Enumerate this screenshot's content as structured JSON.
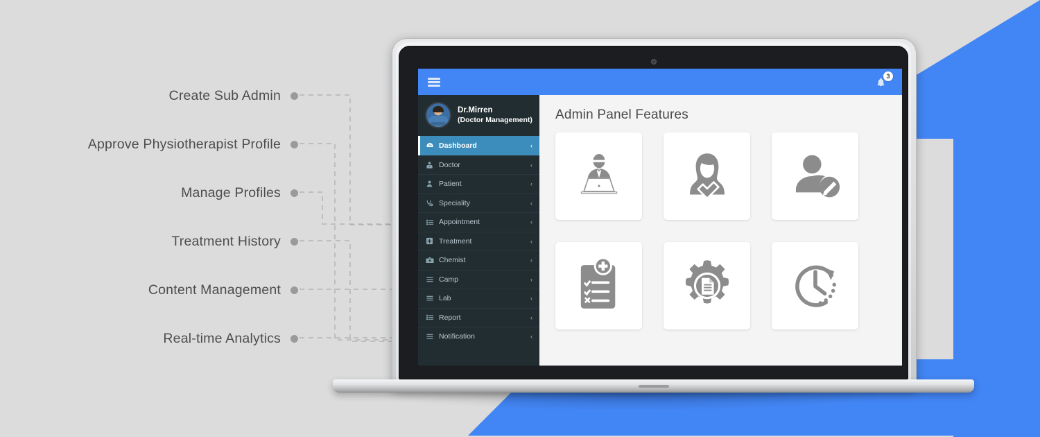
{
  "background": {
    "page_bg": "#dcdcdc",
    "accent_blue": "#4285f4"
  },
  "callouts": [
    {
      "label": "Create Sub Admin"
    },
    {
      "label": "Approve Physiotherapist Profile"
    },
    {
      "label": "Manage Profiles"
    },
    {
      "label": "Treatment History"
    },
    {
      "label": "Content Management"
    },
    {
      "label": "Real-time  Analytics"
    }
  ],
  "app": {
    "topbar": {
      "menu_icon": "hamburger-icon",
      "notification_icon": "bell-icon",
      "notification_count": "3",
      "bar_color": "#4285f4"
    },
    "sidebar": {
      "bg_color": "#222d32",
      "active_color": "#3c8dbc",
      "profile": {
        "avatar": "doctor-avatar",
        "name": "Dr.Mirren",
        "role": "(Doctor Management)"
      },
      "items": [
        {
          "label": "Dashboard",
          "icon": "dashboard-icon",
          "caret": "‹",
          "active": true
        },
        {
          "label": "Doctor",
          "icon": "doctor-icon",
          "caret": "‹",
          "active": false
        },
        {
          "label": "Patient",
          "icon": "patient-icon",
          "caret": "‹",
          "active": false
        },
        {
          "label": "Speciality",
          "icon": "stethoscope-icon",
          "caret": "‹",
          "active": false
        },
        {
          "label": "Appointment",
          "icon": "list-alt-icon",
          "caret": "‹",
          "active": false
        },
        {
          "label": "Treatment",
          "icon": "plus-square-icon",
          "caret": "‹",
          "active": false
        },
        {
          "label": "Chemist",
          "icon": "medkit-icon",
          "caret": "‹",
          "active": false
        },
        {
          "label": "Camp",
          "icon": "bars-icon",
          "caret": "‹",
          "active": false
        },
        {
          "label": "Lab",
          "icon": "bars-icon",
          "caret": "‹",
          "active": false
        },
        {
          "label": "Report",
          "icon": "list-alt-icon",
          "caret": "‹",
          "active": false
        },
        {
          "label": "Notification",
          "icon": "bars-icon",
          "caret": "‹",
          "active": false
        }
      ]
    },
    "main": {
      "title": "Admin Panel Features",
      "bg_color": "#f4f4f4",
      "cards": [
        {
          "icon": "person-at-laptop-icon"
        },
        {
          "icon": "female-user-verified-icon"
        },
        {
          "icon": "user-edit-icon"
        },
        {
          "icon": "medical-clipboard-checklist-icon"
        },
        {
          "icon": "gear-document-icon"
        },
        {
          "icon": "clock-history-icon"
        }
      ]
    }
  }
}
